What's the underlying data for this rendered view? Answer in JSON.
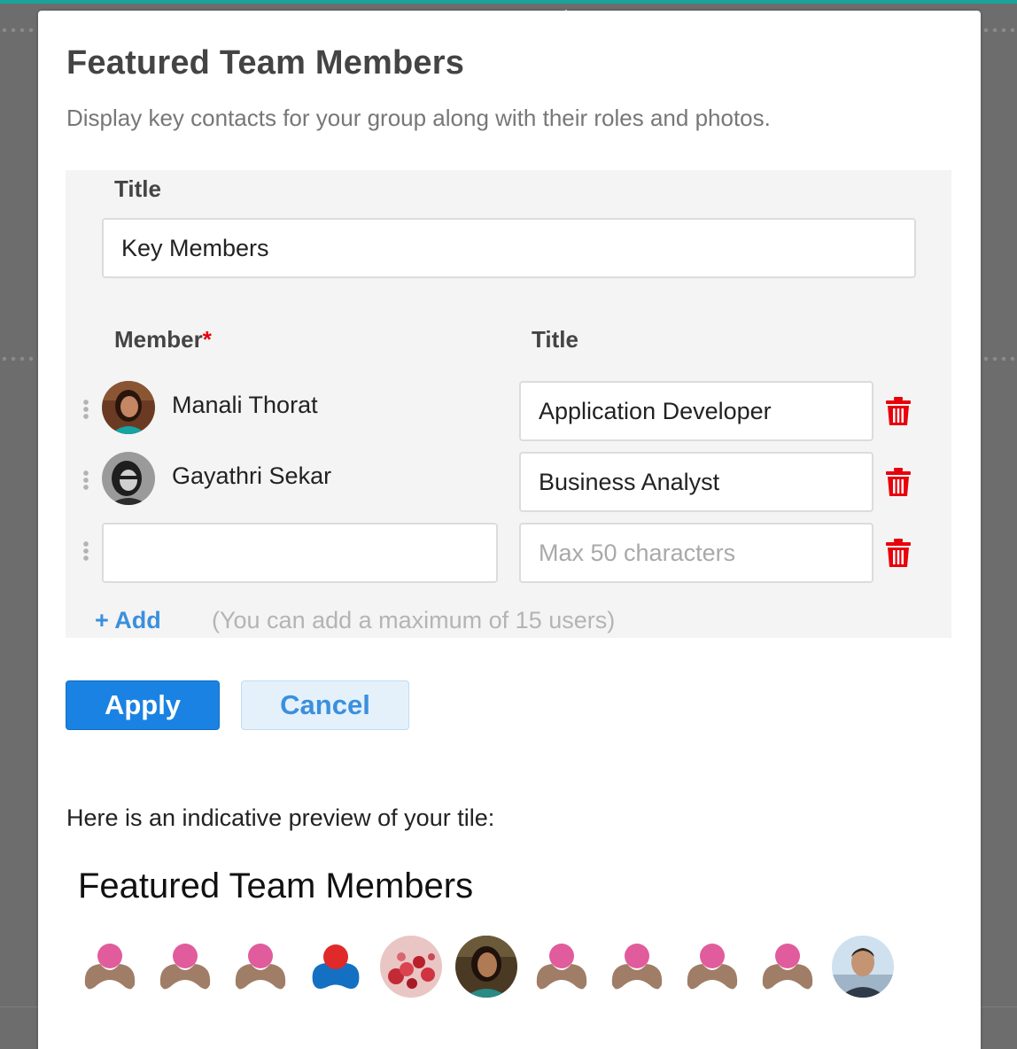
{
  "modal": {
    "title": "Featured Team Members",
    "description": "Display key contacts for your group along with their roles and photos."
  },
  "form": {
    "title_label": "Title",
    "title_value": "Key Members",
    "member_column_label": "Member",
    "required_marker": "*",
    "title_column_label": "Title",
    "members": [
      {
        "name": "Manali Thorat",
        "title": "Application Developer",
        "avatar": "photo-woman"
      },
      {
        "name": "Gayathri Sekar",
        "title": "Business Analyst",
        "avatar": "photo-bw-woman"
      },
      {
        "name": "",
        "title": "",
        "title_placeholder": "Max 50 characters"
      }
    ],
    "add_label": "+ Add",
    "add_note": "(You can add a maximum of 15 users)"
  },
  "actions": {
    "apply_label": "Apply",
    "cancel_label": "Cancel"
  },
  "preview": {
    "label": "Here is an indicative preview of your tile:",
    "tile_title": "Featured Team Members",
    "avatars": [
      "default-avatar-icon",
      "default-avatar-icon",
      "default-avatar-icon",
      "blue-avatar-icon",
      "floral-photo",
      "photo-woman",
      "default-avatar-icon",
      "default-avatar-icon",
      "default-avatar-icon",
      "default-avatar-icon",
      "photo-man"
    ]
  },
  "colors": {
    "primary": "#1a82e2",
    "link": "#3b8fdd",
    "danger": "#e8000b",
    "panel_bg": "#f4f4f4",
    "accent_strip": "#16a59b"
  }
}
